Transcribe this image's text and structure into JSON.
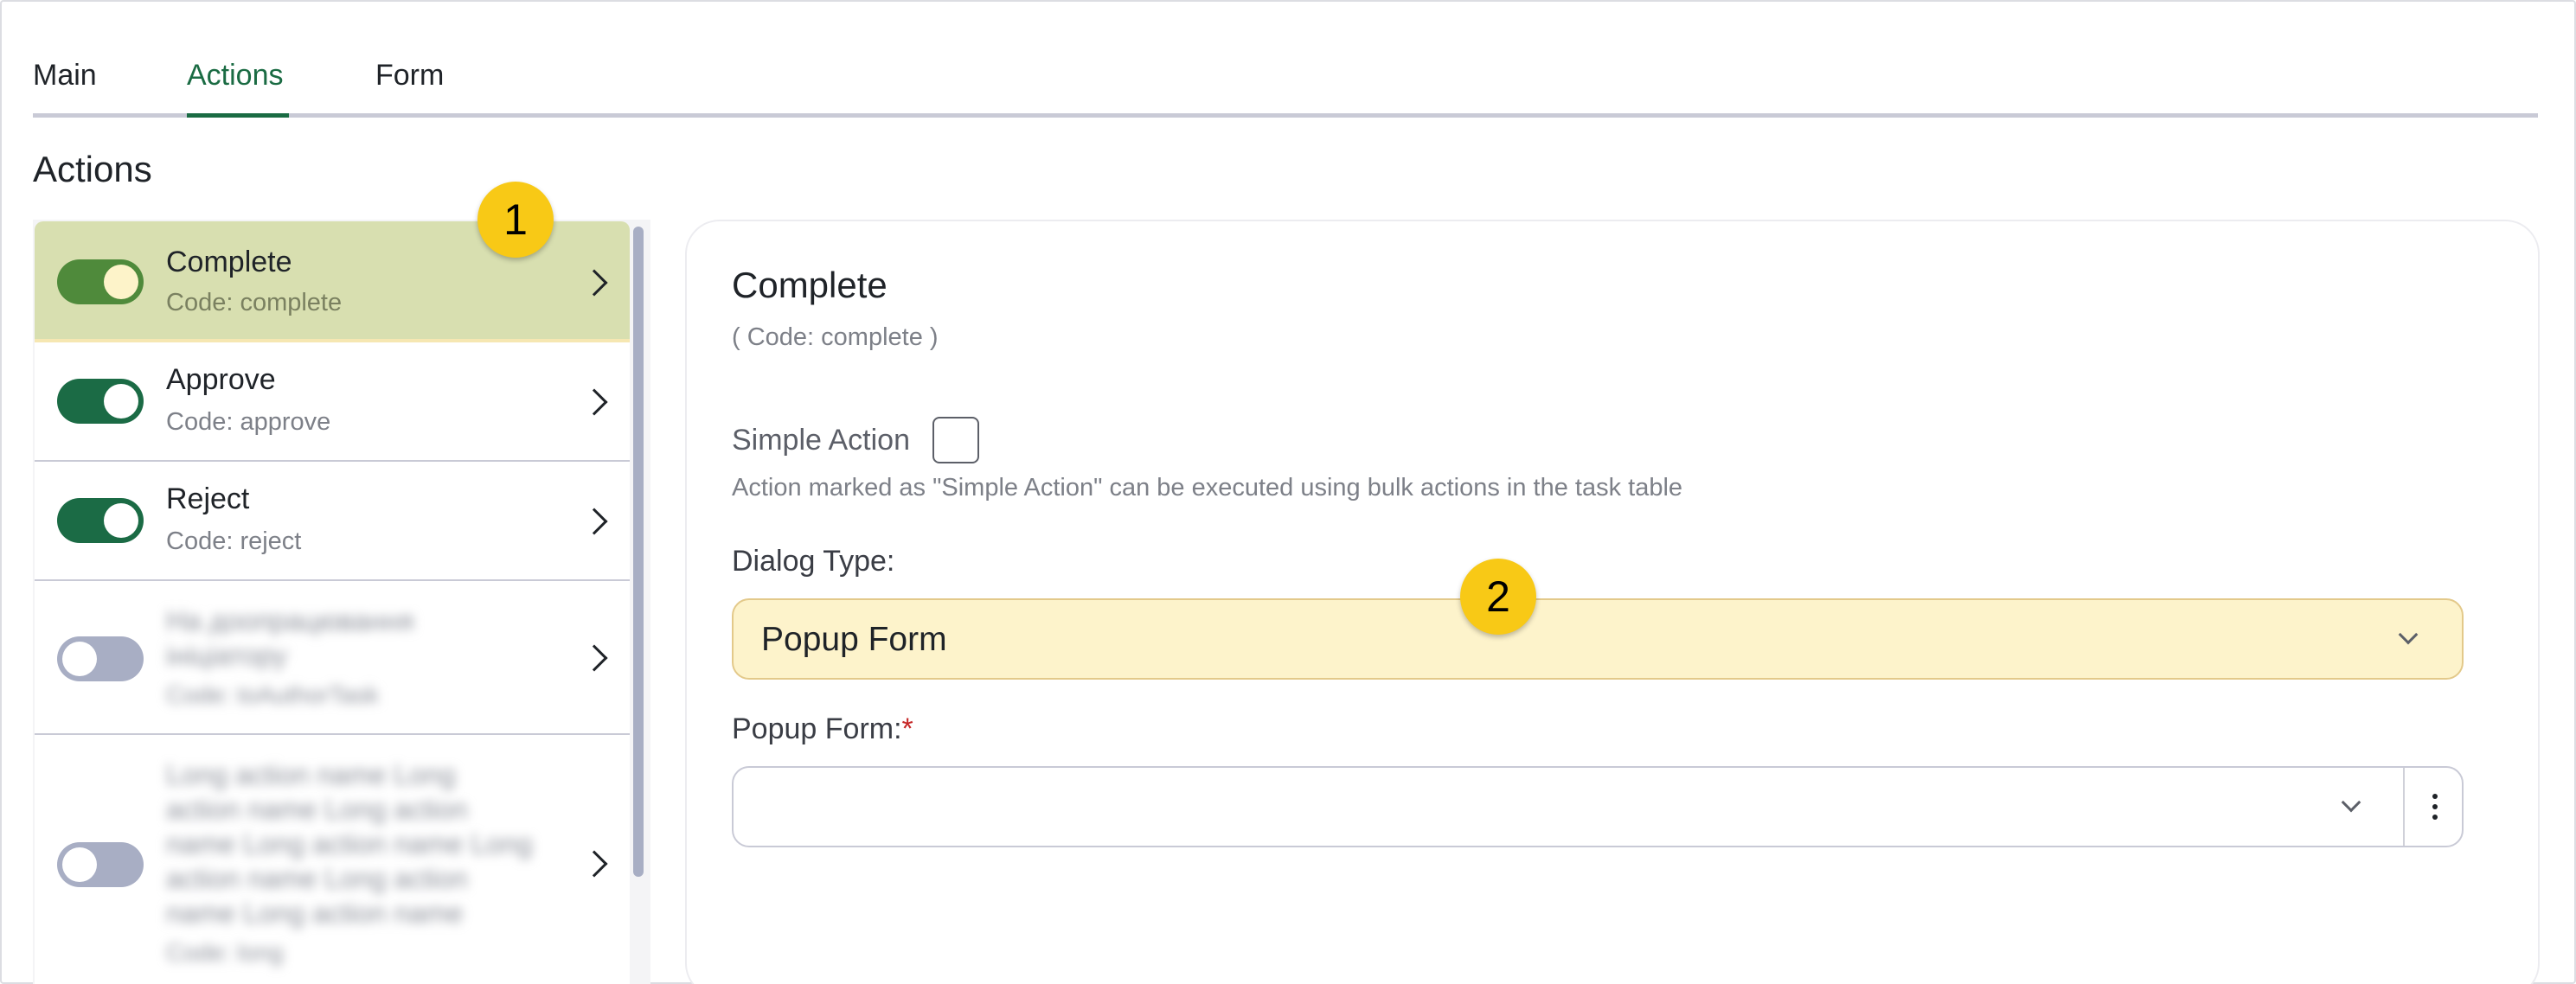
{
  "tabs": [
    {
      "label": "Main",
      "active": false
    },
    {
      "label": "Actions",
      "active": true
    },
    {
      "label": "Form",
      "active": false
    }
  ],
  "section_title": "Actions",
  "actions": [
    {
      "name": "Complete",
      "code": "Code: complete",
      "enabled": true,
      "selected": true
    },
    {
      "name": "Approve",
      "code": "Code: approve",
      "enabled": true,
      "selected": false
    },
    {
      "name": "Reject",
      "code": "Code: reject",
      "enabled": true,
      "selected": false
    },
    {
      "name_lines": [
        "На доопрацювання",
        "ініціатору"
      ],
      "code": "Code: toAuthorTask",
      "enabled": false,
      "blurred": true
    },
    {
      "name_lines": [
        "Long action name Long",
        "action name Long action",
        "name Long action name Long",
        "action name Long action",
        "name Long action name"
      ],
      "code": "Code: long",
      "enabled": false,
      "blurred": true
    }
  ],
  "detail": {
    "title": "Complete",
    "code": "( Code: complete )",
    "simple_action_label": "Simple Action",
    "simple_action_checked": false,
    "simple_action_help": "Action marked as \"Simple Action\" can be executed using bulk actions in the task table",
    "dialog_type_label": "Dialog Type:",
    "dialog_type_value": "Popup Form",
    "popup_form_label": "Popup Form:",
    "popup_form_required_mark": "*",
    "popup_form_value": ""
  },
  "badges": [
    "1",
    "2"
  ],
  "colors": {
    "accent_green": "#1a6b43",
    "selected_row": "#d8dfb0",
    "highlight_field": "#fdf3cb",
    "badge_yellow": "#f8c916",
    "toggle_off": "#a8aec4"
  }
}
